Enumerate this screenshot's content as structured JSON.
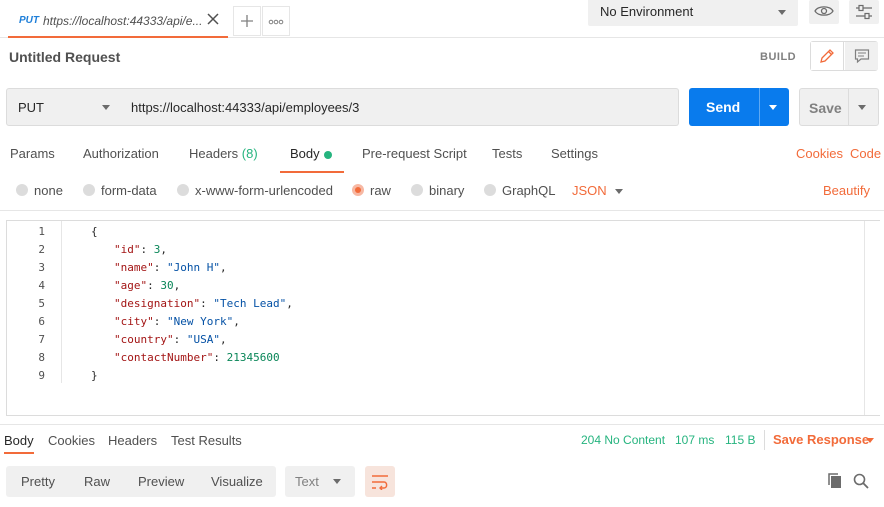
{
  "tab": {
    "method": "PUT",
    "title": "https://localhost:44333/api/e..."
  },
  "environment": {
    "selected": "No Environment"
  },
  "request": {
    "title": "Untitled Request",
    "mode_label": "BUILD",
    "method": "PUT",
    "url": "https://localhost:44333/api/employees/3",
    "send_label": "Send",
    "save_label": "Save"
  },
  "request_tabs": {
    "params": "Params",
    "authorization": "Authorization",
    "headers": "Headers",
    "headers_count": "(8)",
    "body": "Body",
    "prerequest": "Pre-request Script",
    "tests": "Tests",
    "settings": "Settings",
    "cookies": "Cookies",
    "code": "Code"
  },
  "body_types": {
    "none": "none",
    "form_data": "form-data",
    "urlencoded": "x-www-form-urlencoded",
    "raw": "raw",
    "binary": "binary",
    "graphql": "GraphQL",
    "language": "JSON",
    "beautify": "Beautify"
  },
  "editor": {
    "line_numbers": [
      "1",
      "2",
      "3",
      "4",
      "5",
      "6",
      "7",
      "8",
      "9"
    ],
    "lines": [
      {
        "key": "",
        "value": "",
        "raw": "{"
      },
      {
        "key": "\"id\"",
        "value": "3",
        "type": "number"
      },
      {
        "key": "\"name\"",
        "value": "\"John H\"",
        "type": "string"
      },
      {
        "key": "\"age\"",
        "value": "30",
        "type": "number"
      },
      {
        "key": "\"designation\"",
        "value": "\"Tech Lead\"",
        "type": "string"
      },
      {
        "key": "\"city\"",
        "value": "\"New York\"",
        "type": "string"
      },
      {
        "key": "\"country\"",
        "value": "\"USA\"",
        "type": "string"
      },
      {
        "key": "\"contactNumber\"",
        "value": "21345600",
        "type": "number"
      },
      {
        "key": "",
        "value": "",
        "raw": "}"
      }
    ]
  },
  "response": {
    "tabs": {
      "body": "Body",
      "cookies": "Cookies",
      "headers": "Headers",
      "test_results": "Test Results"
    },
    "status": "204 No Content",
    "time": "107 ms",
    "size": "115 B",
    "save_label": "Save Response",
    "view_options": {
      "pretty": "Pretty",
      "raw": "Raw",
      "preview": "Preview",
      "visualize": "Visualize"
    },
    "format": "Text"
  },
  "colors": {
    "accent": "#f26b3a",
    "send": "#097bed",
    "success": "#26b47f"
  }
}
